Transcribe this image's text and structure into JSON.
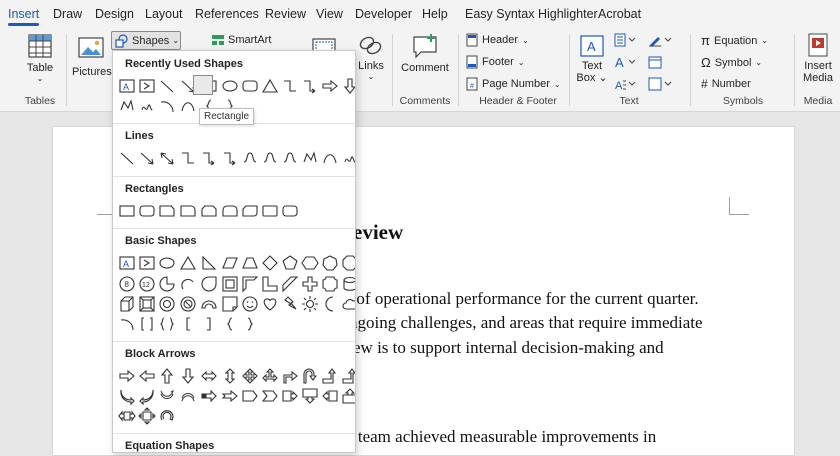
{
  "tabs": [
    "Insert",
    "Draw",
    "Design",
    "Layout",
    "References",
    "Review",
    "View",
    "Developer",
    "Help",
    "Easy Syntax Highlighter",
    "Acrobat"
  ],
  "ribbon": {
    "table": "Table",
    "tables_group": "Tables",
    "pictures": "Pictures",
    "shapes": "Shapes",
    "smartart": "SmartArt",
    "links": "Links",
    "comment": "Comment",
    "comments_group": "Comments",
    "header": "Header",
    "footer": "Footer",
    "page_number": "Page Number",
    "hf_group": "Header & Footer",
    "text_box_1": "Text",
    "text_box_2": "Box",
    "text_group": "Text",
    "equation": "Equation",
    "symbol": "Symbol",
    "number": "Number",
    "symbols_group": "Symbols",
    "insert_media_1": "Insert",
    "insert_media_2": "Media",
    "media_group": "Media"
  },
  "dropdown": {
    "recent": "Recently Used Shapes",
    "lines": "Lines",
    "rectangles": "Rectangles",
    "basic": "Basic Shapes",
    "arrows": "Block Arrows",
    "equation": "Equation Shapes",
    "tooltip": "Rectangle"
  },
  "document": {
    "heading_fragment": "eview",
    "line1": "ry of operational performance for the current quarter.",
    "line2": "ngoing challenges, and areas that require immediate",
    "line3": "ew is to support internal decision-making and",
    "line4": "s team achieved measurable improvements in"
  }
}
